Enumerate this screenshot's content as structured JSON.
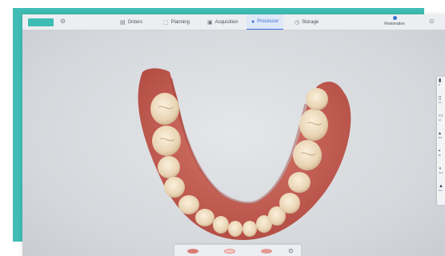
{
  "toolbar": {
    "settings_icon": "gear-icon",
    "tabs": [
      {
        "label": "Orders",
        "icon": "orders-icon"
      },
      {
        "label": "Planning",
        "icon": "planning-icon"
      },
      {
        "label": "Acquisition",
        "icon": "acquisition-icon"
      },
      {
        "label": "Processor",
        "icon": "processor-icon",
        "active": true
      },
      {
        "label": "Storage",
        "icon": "storage-icon"
      }
    ],
    "restoration_label": "Restoration",
    "more_icon": "menu-icon"
  },
  "colors": {
    "accent": "#3fbdb5",
    "active_tab": "#3c6fd6",
    "gum": "#c65e52",
    "tooth": "#ead7ba"
  },
  "side_tools": [
    {
      "label": "E",
      "icon": "edit-icon"
    },
    {
      "label": "Cu",
      "icon": "cut-icon"
    },
    {
      "label": "Al",
      "icon": "align-icon"
    },
    {
      "label": "Dis",
      "icon": "distance-icon"
    },
    {
      "label": "Bi",
      "icon": "bite-icon"
    },
    {
      "label": "Con",
      "icon": "contact-icon"
    },
    {
      "label": "Col",
      "icon": "color-icon"
    }
  ],
  "bottom_bar": {
    "views": [
      "upper-jaw-view",
      "both-jaws-view",
      "lower-jaw-view"
    ],
    "extra_icon": "settings-icon"
  }
}
